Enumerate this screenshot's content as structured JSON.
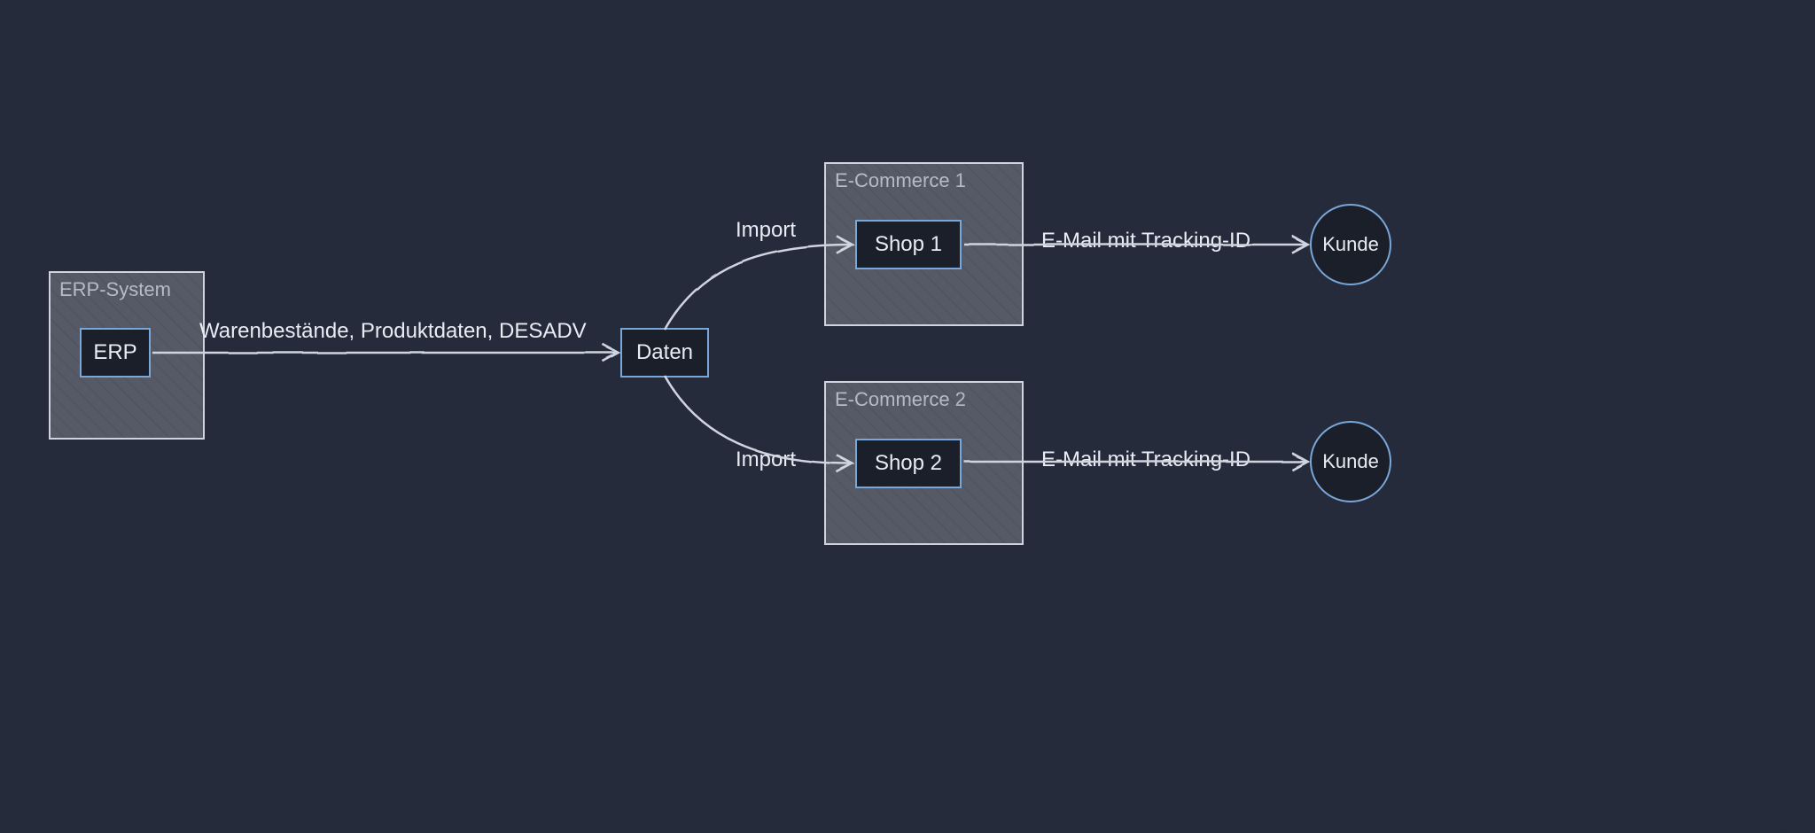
{
  "groups": {
    "erp": {
      "title": "ERP-System"
    },
    "ecom1": {
      "title": "E-Commerce 1"
    },
    "ecom2": {
      "title": "E-Commerce 2"
    }
  },
  "nodes": {
    "erp": "ERP",
    "daten": "Daten",
    "shop1": "Shop 1",
    "shop2": "Shop 2",
    "kunde1": "Kunde",
    "kunde2": "Kunde"
  },
  "edges": {
    "erp_daten": "Warenbestände, Produktdaten, DESADV",
    "daten_shop1": "Import",
    "daten_shop2": "Import",
    "shop1_kunde": "E-Mail mit Tracking-ID",
    "shop2_kunde": "E-Mail mit Tracking-ID"
  }
}
